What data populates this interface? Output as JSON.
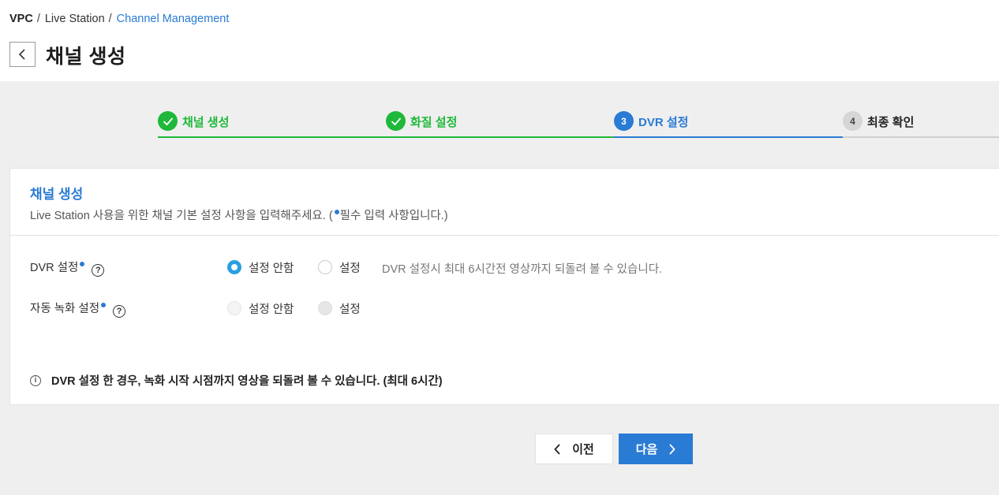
{
  "breadcrumb": {
    "items": [
      "VPC",
      "Live Station",
      "Channel Management"
    ],
    "separator": "/"
  },
  "page": {
    "title": "채널 생성"
  },
  "steps": [
    {
      "num": "1",
      "label": "채널 생성",
      "state": "done"
    },
    {
      "num": "2",
      "label": "화질 설정",
      "state": "done"
    },
    {
      "num": "3",
      "label": "DVR 설정",
      "state": "current"
    },
    {
      "num": "4",
      "label": "최종 확인",
      "state": "pending"
    }
  ],
  "card": {
    "title": "채널 생성",
    "desc_before": "Live Station 사용을 위한 채널 기본 설정 사항을 입력해주세요. (",
    "desc_after": "필수 입력 사항입니다.)",
    "rows": [
      {
        "label": "DVR 설정",
        "options": [
          "설정 안함",
          "설정"
        ],
        "selected": "설정 안함",
        "disabled": false,
        "hint": "DVR 설정시 최대 6시간전 영상까지 되돌려 볼 수 있습니다."
      },
      {
        "label": "자동 녹화 설정",
        "options": [
          "설정 안함",
          "설정"
        ],
        "selected": "설정 안함",
        "disabled": true
      }
    ],
    "note": "DVR 설정 한 경우, 녹화 시작 시점까지 영상을 되돌려 볼 수 있습니다. (최대 6시간)"
  },
  "buttons": {
    "prev": "이전",
    "next": "다음"
  },
  "colors": {
    "done": "#1fb83a",
    "current": "#2a7bd3",
    "radio_on": "#2aa0e0"
  }
}
